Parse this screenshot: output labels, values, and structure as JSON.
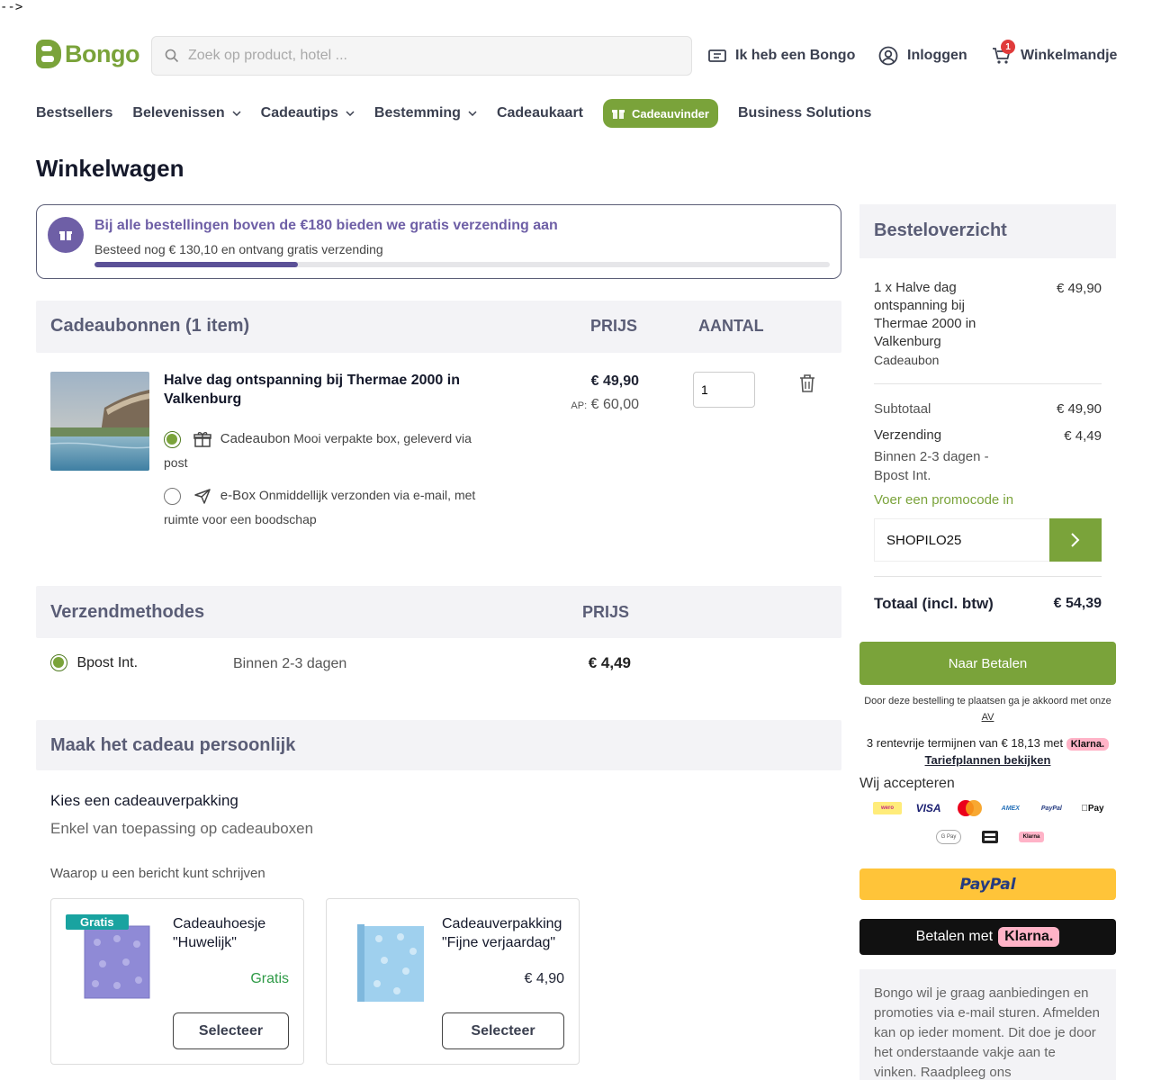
{
  "artifact": "-->",
  "header": {
    "logo": "Bongo",
    "search_placeholder": "Zoek op product, hotel ...",
    "have_bongo": "Ik heb een Bongo",
    "login": "Inloggen",
    "cart": "Winkelmandje",
    "cart_count": "1"
  },
  "nav": {
    "items": [
      "Bestsellers",
      "Belevenissen",
      "Cadeautips",
      "Bestemming",
      "Cadeaukaart"
    ],
    "cta": "Cadeauvinder",
    "business": "Business Solutions"
  },
  "page_title": "Winkelwagen",
  "free_shipping": {
    "title": "Bij alle bestellingen boven de €180 bieden we gratis verzending aan",
    "subtitle": "Besteed nog € 130,10 en ontvang gratis verzending",
    "progress": 0.277
  },
  "cart": {
    "section_title": "Cadeaubonnen (1 item)",
    "col_price": "PRIJS",
    "col_qty": "AANTAL",
    "product": {
      "name": "Halve dag ontspanning bij Thermae 2000 in Valkenburg",
      "price": "€ 49,90",
      "ap_label": "AP:",
      "ap_price": "€ 60,00",
      "quantity": "1",
      "options": [
        {
          "label": "Cadeaubon",
          "desc": "Mooi verpakte box, geleverd via post",
          "selected": true
        },
        {
          "label": "e-Box",
          "desc": "Onmiddellijk verzonden via e-mail, met ruimte voor een boodschap",
          "selected": false
        }
      ]
    }
  },
  "shipping": {
    "section_title": "Verzendmethodes",
    "col_price": "PRIJS",
    "method": "Bpost Int.",
    "duration": "Binnen 2-3 dagen",
    "price": "€ 4,49"
  },
  "personalise": {
    "section_title": "Maak het cadeau persoonlijk",
    "subtitle": "Kies een cadeauverpakking",
    "note": "Enkel van toepassing op cadeauboxen",
    "note2": "Waarop u een bericht kunt schrijven",
    "cards": [
      {
        "tag": "Gratis",
        "name": "Cadeauhoesje \"Huwelijk\"",
        "price": "Gratis",
        "button": "Selecteer"
      },
      {
        "name": "Cadeauverpakking \"Fijne verjaardag\"",
        "price": "€ 4,90",
        "button": "Selecteer"
      }
    ]
  },
  "summary": {
    "title": "Besteloverzicht",
    "item": "1 x Halve dag ontspanning bij Thermae 2000 in Valkenburg",
    "item_type": "Cadeaubon",
    "item_price": "€ 49,90",
    "subtotal_label": "Subtotaal",
    "subtotal": "€ 49,90",
    "shipping_label": "Verzending",
    "shipping_desc": "Binnen 2-3 dagen - Bpost Int.",
    "shipping": "€ 4,49",
    "promo_link": "Voer een promocode in",
    "promo_value": "SHOPILO25",
    "total_label": "Totaal (incl. btw)",
    "total": "€ 54,39",
    "pay_button": "Naar Betalen",
    "terms": "Door deze bestelling te plaatsen ga je akkoord met onze",
    "terms_link": "AV",
    "installments": "3 rentevrije termijnen van € 18,13 met",
    "klarna": "Klarna.",
    "plans_link": "Tariefplannen bekijken",
    "accept": "Wij accepteren",
    "payment_methods": [
      "wero",
      "VISA",
      "mastercard",
      "AMEX",
      "PayPal",
      "Apple Pay",
      "G Pay",
      "Bancontact",
      "Klarna"
    ],
    "paypal_text": "PayPal",
    "klarna_pay_text": "Betalen met",
    "newsletter": "Bongo wil je graag aanbiedingen en promoties via e-mail sturen. Afmelden kan op ieder moment. Dit doe je door het onderstaande vakje aan te vinken. Raadpleeg ons"
  },
  "colors": {
    "brand_green": "#7aa33a",
    "purple": "#6e5fa6",
    "section_bg": "#f3f3f6"
  }
}
